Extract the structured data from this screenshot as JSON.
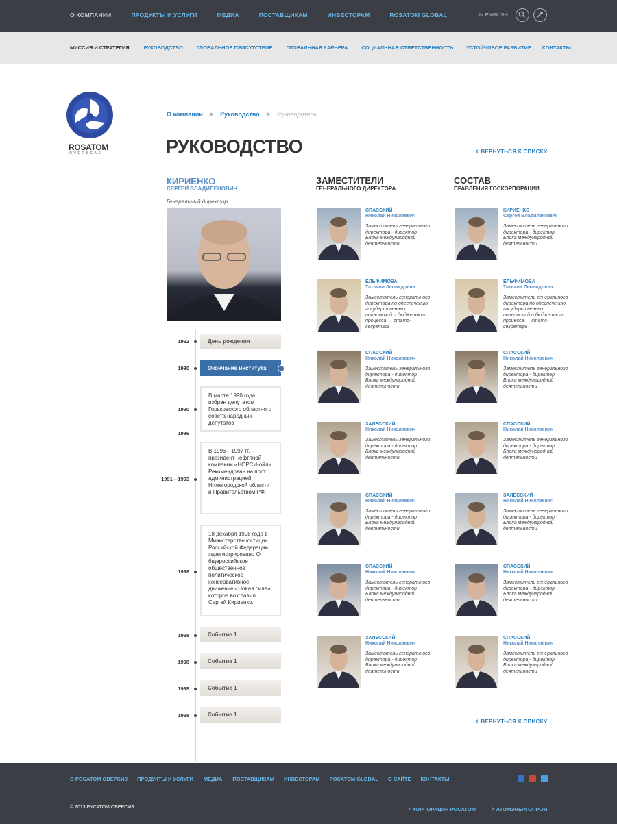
{
  "topnav": {
    "items": [
      "О КОМПАНИИ",
      "ПРОДУКТЫ И УСЛУГИ",
      "МЕДИА",
      "ПОСТАВЩИКАМ",
      "ИНВЕСТОРАМ",
      "ROSATOM GLOBAL"
    ],
    "lang": "IN ENGLISH"
  },
  "subnav": {
    "items": [
      "МИССИЯ И СТРАТЕГИЯ",
      "РУКОВОДСТВО",
      "ГЛОБАЛЬНОЕ ПРИСУТСТВИЕ",
      "ГЛОБАЛЬНАЯ КАРЬЕРА",
      "СОЦИАЛЬНАЯ ОТВЕТСТВЕННОСТЬ",
      "УСТОЙЧИВОЕ РАЗВИТИЕ",
      "КОНТАКТЫ"
    ]
  },
  "logo": {
    "name": "ROSATOM",
    "sub": "OVERSEAS"
  },
  "breadcrumb": {
    "items": [
      "О компании",
      "Руководство",
      "Руководитель"
    ],
    "sep": ">"
  },
  "page": {
    "title": "РУКОВОДСТВО",
    "back_label": "ВЕРНУТЬСЯ К СПИСКУ"
  },
  "ceo": {
    "last": "КИРИЕНКО",
    "first": "СЕРГЕЙ ВЛАДИЛЕНОВИЧ",
    "role": "Генеральный директор"
  },
  "timeline": {
    "events": [
      {
        "year": "1962",
        "label": "День рождения"
      },
      {
        "year": "1980",
        "label": "Окончание института"
      },
      {
        "year": "1998",
        "label": "Событие 1"
      },
      {
        "year": "1998",
        "label": "Событие 1"
      },
      {
        "year": "1998",
        "label": "Событие 1"
      },
      {
        "year": "1998",
        "label": "Событие 1"
      }
    ],
    "cards": [
      {
        "year": "1990",
        "text": "В марте 1990 года избран депутатом Горьковского областного совета народных депутатов"
      },
      {
        "year": "1986",
        "text": ""
      },
      {
        "year": "1991—1993",
        "text": "В 1996—1997 гг. — президент нефтяной компании «НОРСИ-ойл». Рекомендован на пост администрацией Нижегородской области и Правительством РФ."
      },
      {
        "year": "1998",
        "text": "18 декабря 1998 года в Министерстве юстиции Российской Федерации зарегистрировано О бщероссийское общественное политическое консервативное движение «Новая сила», которое возглавил Сергей Кириенко."
      }
    ]
  },
  "deputies": {
    "title": "ЗАМЕСТИТЕЛИ",
    "subtitle": "ГЕНЕРАЛЬНОГО ДИРЕКТОРА",
    "people": [
      {
        "last": "СПАССКИЙ",
        "first": "Николай Николаевич",
        "desc": "Заместитель генерального директора - директор Блока международной деятельности"
      },
      {
        "last": "ЕЛЬФИМОВА",
        "first": "Татьяна Леонидовна",
        "desc": "Заместитель генерального директора по обеспечению государственных полномочий и бюджетного процесса — статс- секретарь"
      },
      {
        "last": "СПАССКИЙ",
        "first": "Николай Николаевич",
        "desc": "Заместитель генерального директора - директор Блока международной деятельности"
      },
      {
        "last": "ЗАЛЕССКИЙ",
        "first": "Николай Николаевич",
        "desc": "Заместитель генерального директора - директор Блока международной деятельности"
      },
      {
        "last": "СПАССКИЙ",
        "first": "Николай Николаевич",
        "desc": "Заместитель генерального директора - директор Блока международной деятельности"
      },
      {
        "last": "СПАССКИЙ",
        "first": "Николай Николаевич",
        "desc": "Заместитель генерального директора - директор Блока международной деятельности"
      },
      {
        "last": "ЗАЛЕССКИЙ",
        "first": "Николай Николаевич",
        "desc": "Заместитель генерального директора - директор Блока международной деятельности"
      }
    ]
  },
  "board": {
    "title": "СОСТАВ",
    "subtitle": "ПРАВЛЕНИЯ ГОСКОРПОРАЦИИ",
    "people": [
      {
        "last": "КИРИЕНКО",
        "first": "Сергей Владиленович",
        "desc": "Заместитель генерального директора - директор Блока международной деятельности"
      },
      {
        "last": "ЕЛЬФИМОВА",
        "first": "Татьяна Леонидовна",
        "desc": "Заместитель генерального директора по обеспечению государственных полномочий и бюджетного процесса — статс- секретарь"
      },
      {
        "last": "СПАССКИЙ",
        "first": "Николай Николаевич",
        "desc": "Заместитель генерального директора - директор Блока международной деятельности"
      },
      {
        "last": "СПАССКИЙ",
        "first": "Николай Николаевич",
        "desc": "Заместитель генерального директора - директор Блока международной деятельности"
      },
      {
        "last": "ЗАЛЕССКИЙ",
        "first": "Николай Николаевич",
        "desc": "Заместитель генерального директора - директор Блока международной деятельности"
      },
      {
        "last": "СПАССКИЙ",
        "first": "Николай Николаевич",
        "desc": "Заместитель генерального директора - директор Блока международной деятельности"
      },
      {
        "last": "СПАССКИЙ",
        "first": "Николай Николаевич",
        "desc": "Заместитель генерального директора - директор Блока международной деятельности"
      }
    ]
  },
  "footer": {
    "nav": [
      "О РОСАТОМ ОВЕРСИЗ",
      "ПРОДУКТЫ И УСЛУГИ",
      "МЕДИА",
      "ПОСТАВЩИКАМ",
      "ИНВЕСТОРАМ",
      "РОСАТОМ GLOBAL",
      "О САЙТЕ",
      "КОНТАКТЫ"
    ],
    "copyright": "© 2013 РУСАТОМ ОВЕРСИЗ",
    "links": [
      "КОРПОРАЦИЯ РОСАТОМ",
      "АТОМЭНЕРГОПРОМ"
    ]
  },
  "colors": {
    "accent": "#2a7fbf",
    "dark": "#3b3f45"
  }
}
